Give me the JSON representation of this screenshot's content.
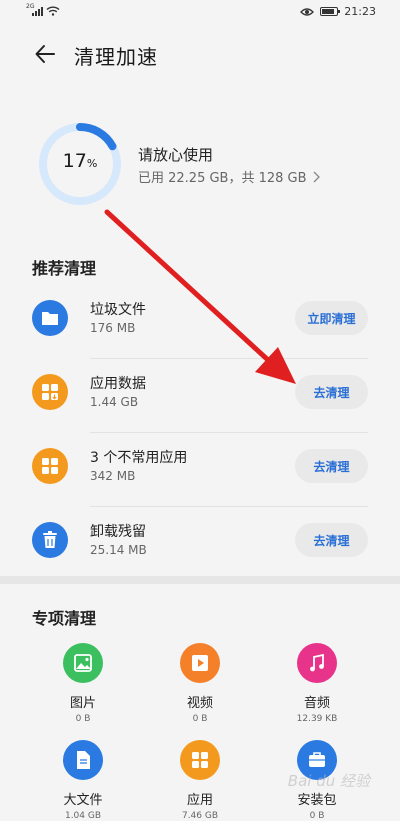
{
  "status_bar": {
    "network": "2G",
    "time": "21:23"
  },
  "header": {
    "title": "清理加速"
  },
  "storage": {
    "percent_label": "17",
    "percent_unit": "%",
    "percent_fraction": 0.17,
    "status": "请放心使用",
    "used": "已用 22.25 GB，共 128 GB"
  },
  "recommended": {
    "title": "推荐清理",
    "items": [
      {
        "name": "垃圾文件",
        "size": "176 MB",
        "action": "立即清理",
        "icon": "folder-icon",
        "color": "#2a7ae2"
      },
      {
        "name": "应用数据",
        "size": "1.44 GB",
        "action": "去清理",
        "icon": "app-data-icon",
        "color": "#f39a1e"
      },
      {
        "name": "3 个不常用应用",
        "size": "342 MB",
        "action": "去清理",
        "icon": "apps-icon",
        "color": "#f39a1e"
      },
      {
        "name": "卸载残留",
        "size": "25.14 MB",
        "action": "去清理",
        "icon": "trash-icon",
        "color": "#2a7ae2"
      }
    ]
  },
  "special": {
    "title": "专项清理",
    "items": [
      {
        "label": "图片",
        "size": "0 B",
        "icon": "image-icon",
        "color": "#3bbf5f"
      },
      {
        "label": "视频",
        "size": "0 B",
        "icon": "video-icon",
        "color": "#f4802a"
      },
      {
        "label": "音频",
        "size": "12.39 KB",
        "icon": "music-icon",
        "color": "#e8338a"
      },
      {
        "label": "大文件",
        "size": "1.04 GB",
        "icon": "document-icon",
        "color": "#2a7ae2"
      },
      {
        "label": "应用",
        "size": "7.46 GB",
        "icon": "apps-icon",
        "color": "#f39a1e"
      },
      {
        "label": "安装包",
        "size": "0 B",
        "icon": "package-icon",
        "color": "#2a7ae2"
      }
    ]
  },
  "watermark": "Bai du 经验"
}
